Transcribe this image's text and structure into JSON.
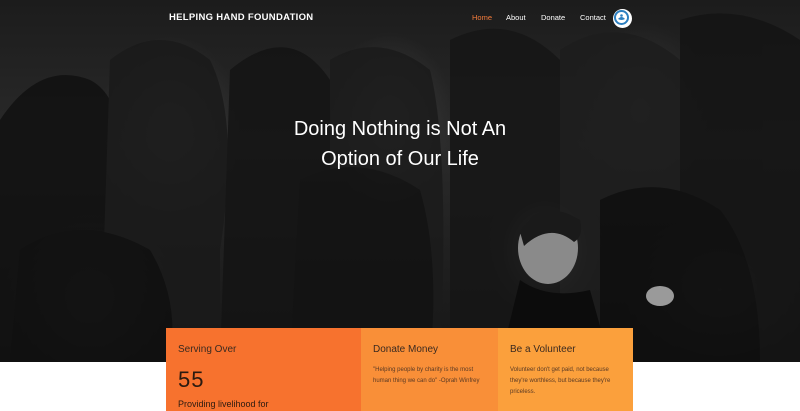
{
  "header": {
    "brand": "HELPING HAND FOUNDATION",
    "nav": [
      {
        "label": "Home",
        "active": true
      },
      {
        "label": "About",
        "active": false
      },
      {
        "label": "Donate",
        "active": false
      },
      {
        "label": "Contact",
        "active": false
      }
    ],
    "logo_icon": "helping-hand-logo-icon"
  },
  "hero": {
    "headline_line1": "Doing Nothing is Not An",
    "headline_line2": "Option of Our Life"
  },
  "cards": {
    "serving": {
      "title": "Serving Over",
      "number": "55",
      "subtitle": "Providing livelihood for"
    },
    "donate": {
      "title": "Donate Money",
      "text": "\"Helping people by charity is the most human thing we can do\" -Oprah Winfrey"
    },
    "volunteer": {
      "title": "Be a Volunteer",
      "text": "Volunteer don't get paid, not because they're worthless, but because they're priceless."
    }
  },
  "colors": {
    "accent": "#f47c3c",
    "card_serving": "#f7722e",
    "card_donate": "#f98f38",
    "card_volunteer": "#fba03c"
  }
}
